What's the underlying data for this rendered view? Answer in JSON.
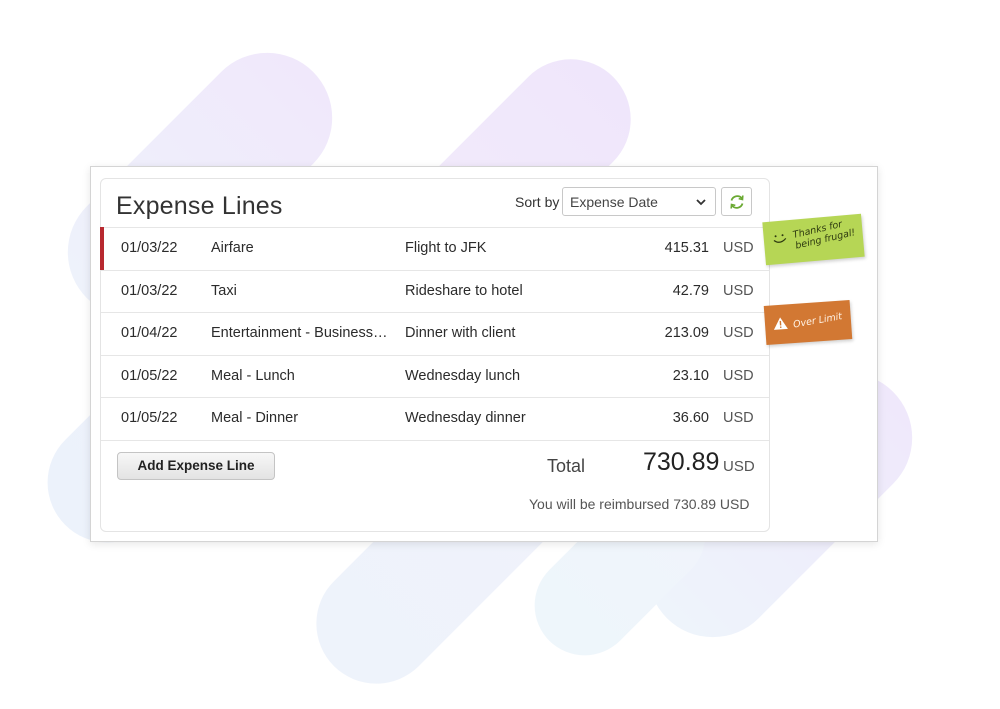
{
  "panel": {
    "title": "Expense Lines",
    "sort_label": "Sort by",
    "sort_value": "Expense Date"
  },
  "rows": [
    {
      "date": "01/03/22",
      "category": "Airfare",
      "description": "Flight to JFK",
      "amount": "415.31",
      "currency": "USD",
      "flagged": true
    },
    {
      "date": "01/03/22",
      "category": "Taxi",
      "description": "Rideshare to hotel",
      "amount": "42.79",
      "currency": "USD",
      "flagged": false
    },
    {
      "date": "01/04/22",
      "category": "Entertainment - Business …",
      "description": "Dinner with client",
      "amount": "213.09",
      "currency": "USD",
      "flagged": false
    },
    {
      "date": "01/05/22",
      "category": "Meal - Lunch",
      "description": "Wednesday lunch",
      "amount": "23.10",
      "currency": "USD",
      "flagged": false
    },
    {
      "date": "01/05/22",
      "category": "Meal - Dinner",
      "description": "Wednesday dinner",
      "amount": "36.60",
      "currency": "USD",
      "flagged": false
    }
  ],
  "footer": {
    "add_button": "Add Expense Line",
    "total_label": "Total",
    "total_value": "730.89",
    "total_currency": "USD",
    "reimbursement": "You will be reimbursed 730.89 USD"
  },
  "notes": {
    "frugal_line1": "Thanks for",
    "frugal_line2": "being frugal!",
    "over_limit": "Over Limit"
  },
  "colors": {
    "flag": "#b8292f",
    "note_green": "#b6d655",
    "note_orange": "#d27833",
    "refresh_icon": "#6aa932"
  },
  "icons": [
    "chevron-down-icon",
    "refresh-icon",
    "smile-icon",
    "warning-icon"
  ]
}
